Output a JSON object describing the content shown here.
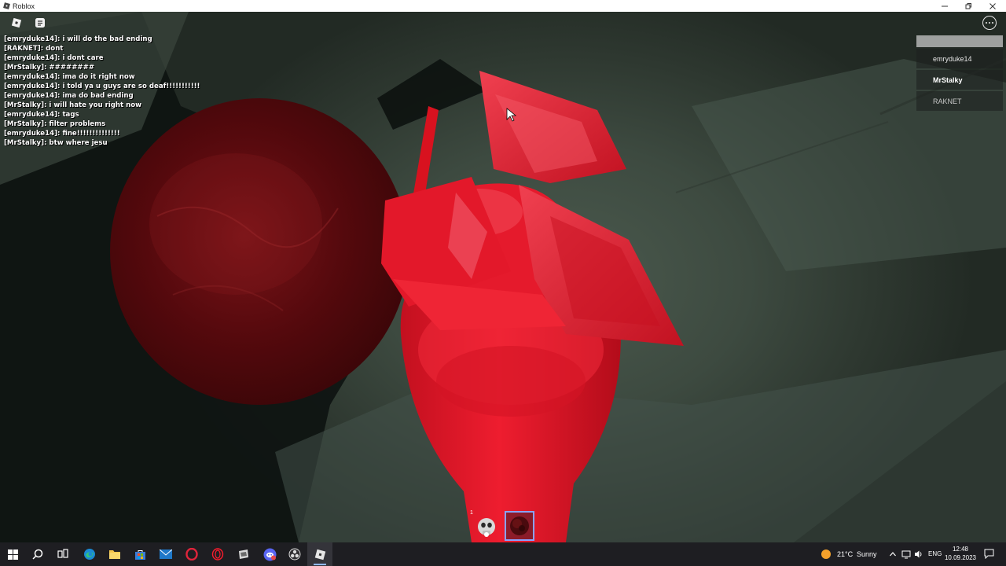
{
  "window": {
    "title": "Roblox",
    "controls": [
      "minimize",
      "maximize",
      "close"
    ]
  },
  "chat": {
    "messages": [
      {
        "text": "[emryduke14]: i will do the bad ending"
      },
      {
        "text": "[RAKNET]: dont"
      },
      {
        "text": "[emryduke14]: i dont care"
      },
      {
        "text": "[MrStalky]: ########"
      },
      {
        "text": "[emryduke14]: ima do it right now"
      },
      {
        "text": "[emryduke14]: i told ya u guys are so deaf!!!!!!!!!!!"
      },
      {
        "text": "[emryduke14]: ima do bad ending"
      },
      {
        "text": "[MrStalky]: i will hate you right now"
      },
      {
        "text": "[emryduke14]: tags"
      },
      {
        "text": "[MrStalky]: filter problems"
      },
      {
        "text": "[emryduke14]: fine!!!!!!!!!!!!!!"
      },
      {
        "text": "[MrStalky]: btw where jesu"
      }
    ]
  },
  "player_list": {
    "players": [
      {
        "name": "emryduke14"
      },
      {
        "name": "MrStalky"
      },
      {
        "name": "RAKNET"
      }
    ]
  },
  "hotbar": {
    "slots": [
      {
        "number": "1",
        "icon": "skull-tool-icon"
      },
      {
        "number": "",
        "icon": "dark-orb-tool-icon"
      }
    ],
    "selected_index": 1
  },
  "taskbar": {
    "apps": [
      "start-icon",
      "search-icon",
      "task-view-icon",
      "edge-icon",
      "file-explorer-icon",
      "store-icon",
      "mail-icon",
      "opera-gx-icon",
      "opera-icon",
      "app-icon",
      "discord-icon",
      "obs-icon",
      "roblox-icon"
    ],
    "weather": {
      "temp": "21°C",
      "condition": "Sunny"
    },
    "language": "ENG",
    "time": "12:48",
    "date": "10.09.2023"
  },
  "colors": {
    "character_red": "#e8152a",
    "dark_orb": "#5a0a0e",
    "ground": "#3d4a40",
    "taskbar": "#1e1e22"
  }
}
